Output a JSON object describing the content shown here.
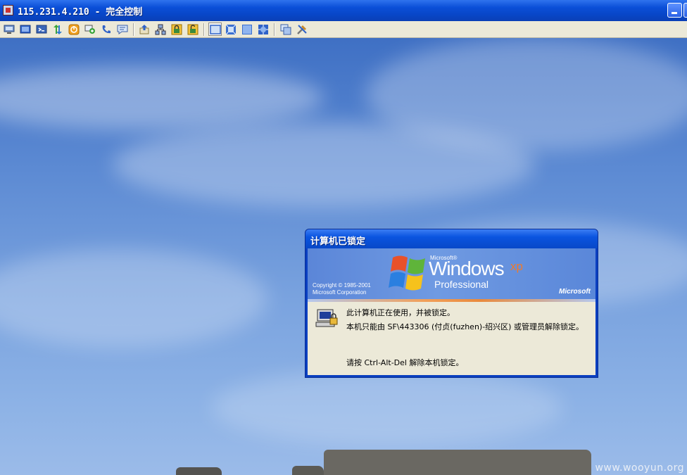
{
  "window": {
    "title": "115.231.4.210 - 完全控制"
  },
  "toolbar": {
    "buttons": [
      {
        "name": "connection-options-icon"
      },
      {
        "name": "full-screen-icon"
      },
      {
        "name": "ctrl-alt-del-icon"
      },
      {
        "name": "refresh-icon"
      },
      {
        "name": "power-icon"
      },
      {
        "name": "chat-icon"
      },
      {
        "name": "voice-call-icon"
      },
      {
        "name": "message-icon"
      },
      {
        "name": "file-transfer-icon"
      },
      {
        "name": "network-icon"
      },
      {
        "name": "lock-icon"
      },
      {
        "name": "unlock-icon"
      },
      {
        "name": "view-normal-icon"
      },
      {
        "name": "view-fit-icon"
      },
      {
        "name": "view-stretch-icon"
      },
      {
        "name": "view-fullscreen-icon"
      },
      {
        "name": "switch-window-icon"
      },
      {
        "name": "tools-icon"
      }
    ],
    "pressed_index": 12
  },
  "dialog": {
    "title": "计算机已锁定",
    "banner": {
      "copyright_line1": "Copyright © 1985-2001",
      "copyright_line2": "Microsoft Corporation",
      "microsoft_small": "Microsoft®",
      "windows": "Windows",
      "xp": "xp",
      "professional": "Professional",
      "microsoft_brand": "Microsoft"
    },
    "messages": {
      "line1": "此计算机正在使用，并被锁定。",
      "line2": "本机只能由 SF\\443306 (付贞(fuzhen)-绍兴区) 或管理员解除锁定。",
      "line3": "请按 Ctrl-Alt-Del 解除本机锁定。"
    }
  },
  "watermark": "www.wooyun.org",
  "colors": {
    "titlebar": "#0b4fd8",
    "toolbar": "#ece9d8",
    "xp_orange": "#f07a2a",
    "dialog_body": "#ece9d8"
  }
}
